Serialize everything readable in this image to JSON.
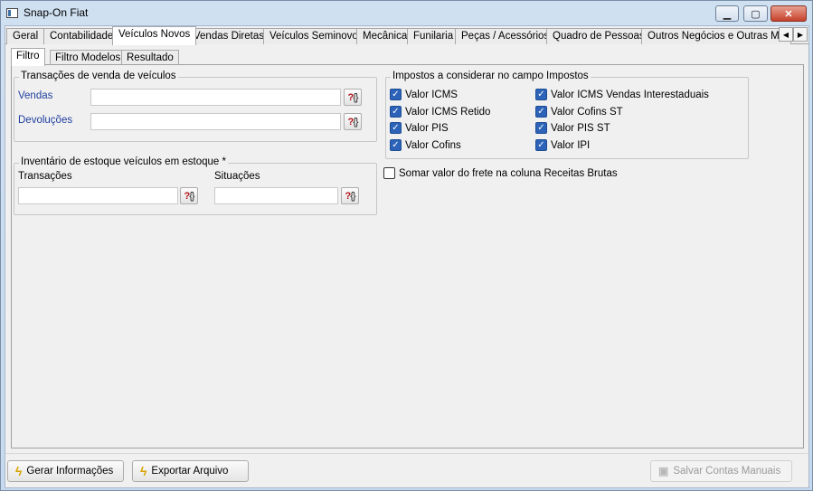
{
  "window": {
    "title": "Snap-On Fiat"
  },
  "top_tabs": [
    "Geral",
    "Contabilidade",
    "Veículos Novos",
    "Vendas Diretas",
    "Veículos Seminovos",
    "Mecânica",
    "Funilaria",
    "Peças / Acessórios",
    "Quadro de Pessoas",
    "Outros Negócios e Outras Mar"
  ],
  "active_top_tab": "Veículos Novos",
  "sub_tabs": [
    "Filtro",
    "Filtro Modelos",
    "Resultado"
  ],
  "active_sub_tab": "Filtro",
  "transacoes": {
    "title": "Transações de venda de veículos",
    "vendas_label": "Vendas",
    "devolucoes_label": "Devoluções"
  },
  "inventario": {
    "title": "Inventário de estoque veículos em estoque *",
    "transacoes_label": "Transações",
    "situacoes_label": "Situações"
  },
  "impostos": {
    "title": "Impostos a considerar no campo Impostos",
    "items": [
      {
        "label": "Valor ICMS",
        "checked": true
      },
      {
        "label": "Valor ICMS Retido",
        "checked": true
      },
      {
        "label": "Valor PIS",
        "checked": true
      },
      {
        "label": "Valor Cofins",
        "checked": true
      },
      {
        "label": "Valor ICMS Vendas Interestaduais",
        "checked": true
      },
      {
        "label": "Valor Cofins ST",
        "checked": true
      },
      {
        "label": "Valor PIS ST",
        "checked": true
      },
      {
        "label": "Valor IPI",
        "checked": true
      }
    ]
  },
  "frete": {
    "label": "Somar valor do frete na coluna Receitas Brutas",
    "checked": false
  },
  "buttons": {
    "gerar": "Gerar Informações",
    "exportar": "Exportar Arquivo",
    "salvar": "Salvar Contas Manuais"
  },
  "icons": {
    "lookup": "?{}",
    "lightning": "lightning-icon",
    "save": "save-icon"
  }
}
